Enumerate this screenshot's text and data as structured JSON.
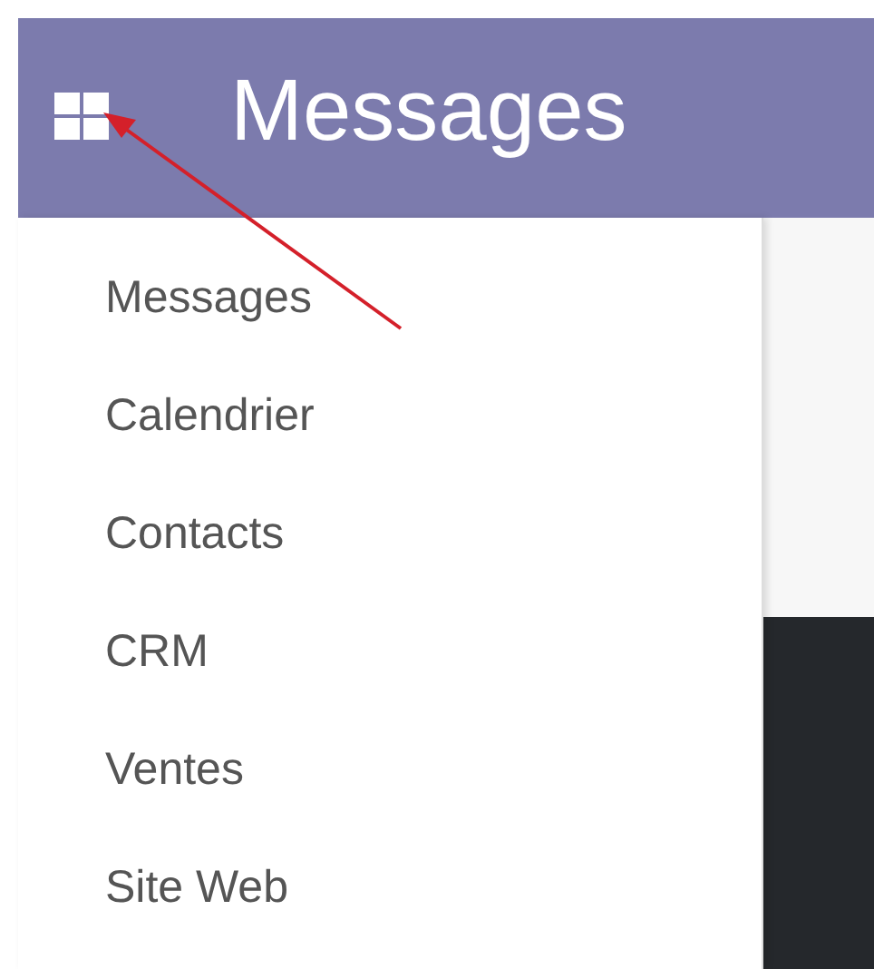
{
  "header": {
    "title": "Messages"
  },
  "menu": {
    "items": [
      {
        "label": "Messages"
      },
      {
        "label": "Calendrier"
      },
      {
        "label": "Contacts"
      },
      {
        "label": "CRM"
      },
      {
        "label": "Ventes"
      },
      {
        "label": "Site Web"
      }
    ]
  }
}
